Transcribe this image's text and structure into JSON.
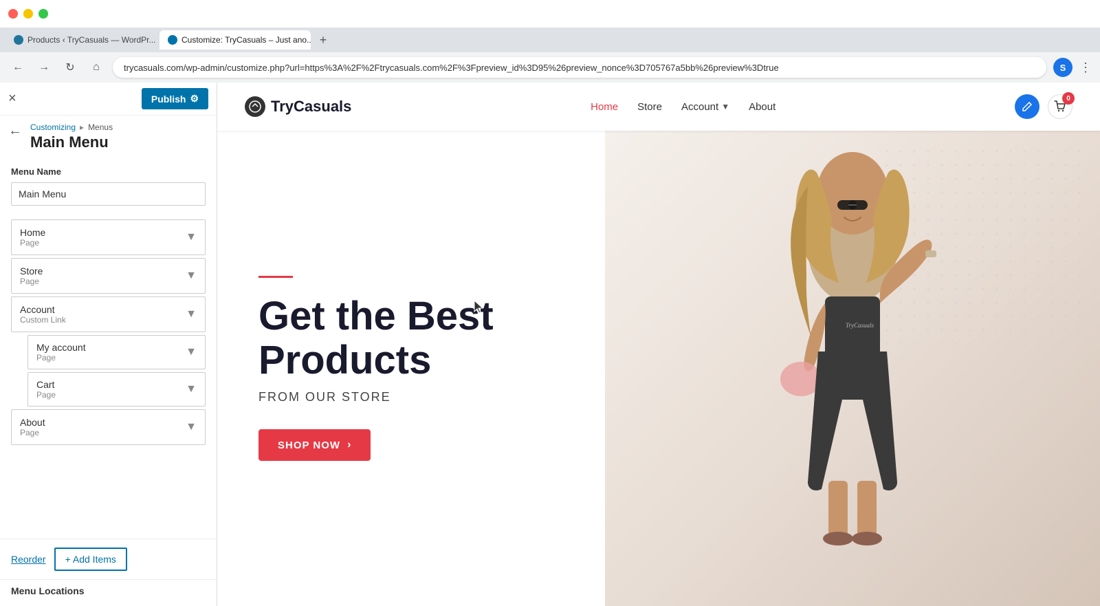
{
  "browser": {
    "tabs": [
      {
        "id": "tab-products",
        "favicon": "wp",
        "label": "Products ‹ TryCasuals — WordPr...",
        "active": false,
        "close": "×"
      },
      {
        "id": "tab-customize",
        "favicon": "customize",
        "label": "Customize: TryCasuals – Just ano...",
        "active": true,
        "close": "×"
      }
    ],
    "new_tab": "+",
    "address": "trycasuals.com/wp-admin/customize.php?url=https%3A%2F%2Ftrycasuals.com%2F%3Fpreview_id%3D95%26preview_nonce%3D705767a5bb%26preview%3Dtrue",
    "nav": {
      "back": "←",
      "forward": "→",
      "refresh": "↻",
      "home": "⌂"
    },
    "profile_letter": "S",
    "menu_dots": "⋮"
  },
  "customizer": {
    "close_label": "×",
    "publish_label": "Publish",
    "gear_label": "⚙",
    "breadcrumb_parent": "Customizing",
    "breadcrumb_sep": "▸",
    "breadcrumb_child": "Menus",
    "back_arrow": "←",
    "section_title": "Main Menu",
    "menu_name_label": "Menu Name",
    "menu_name_value": "Main Menu",
    "menu_items": [
      {
        "name": "Home",
        "type": "Page",
        "arrow": "▾"
      },
      {
        "name": "Store",
        "type": "Page",
        "arrow": "▾"
      },
      {
        "name": "Account",
        "type": "Custom Link",
        "arrow": "▾"
      },
      {
        "name": "About",
        "type": "Page",
        "arrow": "▾"
      }
    ],
    "sub_items": [
      {
        "name": "My account",
        "type": "Page",
        "arrow": "▾"
      },
      {
        "name": "Cart",
        "type": "Page",
        "arrow": "▾"
      }
    ],
    "reorder_label": "Reorder",
    "add_items_label": "+ Add Items",
    "menu_locations_label": "Menu Locations"
  },
  "website": {
    "logo_text": "TryCasuals",
    "logo_icon": "✏",
    "nav_links": [
      {
        "label": "Home",
        "active": true
      },
      {
        "label": "Store",
        "active": false
      },
      {
        "label": "Account",
        "active": false,
        "has_arrow": true
      },
      {
        "label": "About",
        "active": false
      }
    ],
    "cart_count": "0",
    "hero": {
      "heading_line1": "Get the Best",
      "heading_line2": "Products",
      "subheading": "FROM OUR STORE",
      "cta_label": "SHOP NOW",
      "cta_arrow": "›"
    },
    "edit_pencil": "✏"
  }
}
